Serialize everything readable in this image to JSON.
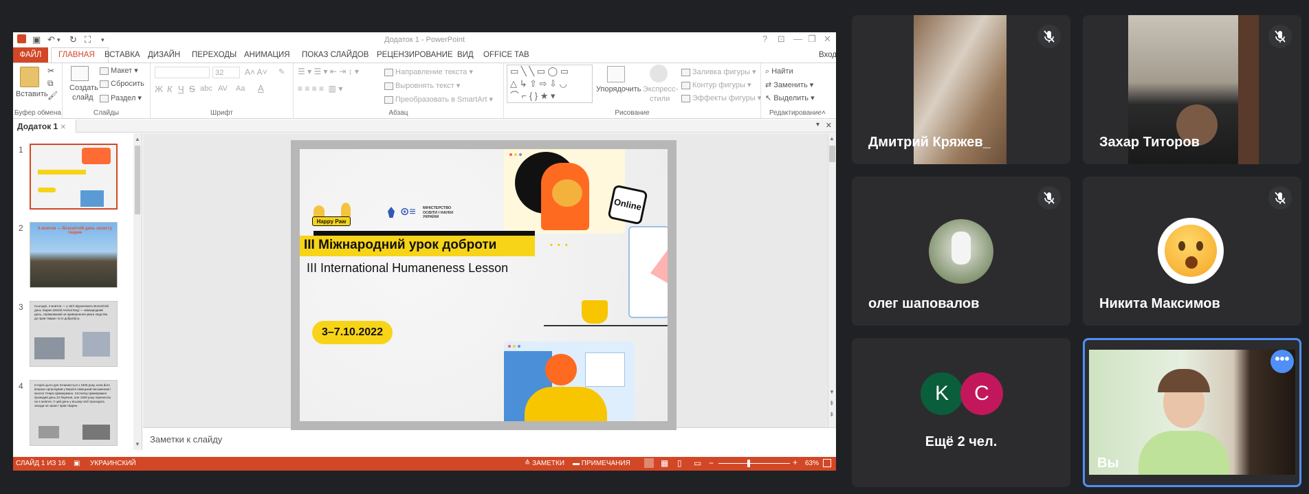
{
  "ppt": {
    "window_title": "Додаток 1 - PowerPoint",
    "menu": {
      "file": "ФАЙЛ",
      "tabs": [
        "ГЛАВНАЯ",
        "ВСТАВКА",
        "ДИЗАЙН",
        "ПЕРЕХОДЫ",
        "АНИМАЦИЯ",
        "ПОКАЗ СЛАЙДОВ",
        "РЕЦЕНЗИРОВАНИЕ",
        "ВИД",
        "OFFICE TAB"
      ],
      "signin": "Вход"
    },
    "ribbon": {
      "paste": "Вставить",
      "clipboard_label": "Буфер обмена",
      "new_slide": "Создать",
      "new_slide2": "слайд",
      "layout": "Макет",
      "reset": "Сбросить",
      "section": "Раздел",
      "slides_label": "Слайды",
      "font_size": "32",
      "bold": "Ж",
      "italic": "К",
      "underline": "Ч",
      "strike": "S",
      "shadow": "abc",
      "spacing": "AV",
      "case": "Aa",
      "font_label": "Шрифт",
      "text_direction": "Направление текста",
      "align_text": "Выровнять текст",
      "smartart": "Преобразовать в SmartArt",
      "paragraph_label": "Абзац",
      "arrange": "Упорядочить",
      "quick_styles": "Экспресс-",
      "quick_styles2": "стили",
      "fill": "Заливка фигуры",
      "outline": "Контур фигуры",
      "effects": "Эффекты фигуры",
      "drawing_label": "Рисование",
      "find": "Найти",
      "replace": "Заменить",
      "select": "Выделить",
      "editing_label": "Редактирование"
    },
    "doc_tab": "Додаток 1",
    "thumbnails": [
      {
        "num": "1"
      },
      {
        "num": "2",
        "text": "4 жовтня — Всесвітній день захисту тварин"
      },
      {
        "num": "3",
        "text": "Сьогодні, 4 жовтня — у світі відзначають Всесвітній день тварин (World Animal Day) — міжнародний день, спрямований на привернення уваги людства до прав тварин та їх добробуту."
      },
      {
        "num": "4",
        "text": "Історія цього дня починається з 1925 року, коли його вперше організував у Берліні німецький письменник і кінолог Генріх Ціммерманн. Спочатку Ціммерманн проводив день 24 березня, але 1929 року перенесли на 4 жовтня. У цей день у всьому світі проходять заходи на захист прав тварин."
      }
    ],
    "slide": {
      "brand": "Happy Paw",
      "ministry": "МІНІСТЕРСТВО ОСВІТИ І НАУКИ УКРАЇНИ",
      "online": "Online",
      "title_ua": "III Міжнародний урок доброти",
      "title_en": "III International Humaneness Lesson",
      "date": "3–7.10.2022",
      "dots": "• • •"
    },
    "notes_placeholder": "Заметки к слайду",
    "status": {
      "slide": "СЛАЙД 1 ИЗ 16",
      "language": "УКРАИНСКИЙ",
      "notes": "ЗАМЕТКИ",
      "comments": "ПРИМЕЧАНИЯ",
      "zoom": "63%",
      "minus": "−",
      "plus": "+"
    }
  },
  "meet": {
    "participants": [
      {
        "name": "Дмитрий Кряжев_",
        "muted": true
      },
      {
        "name": "Захар Титоров",
        "muted": true
      },
      {
        "name": "олег шаповалов",
        "muted": true
      },
      {
        "name": "Никита Максимов",
        "muted": true
      },
      {
        "name": "Ещё 2 чел.",
        "avatars": [
          "K",
          "C"
        ]
      },
      {
        "name": "Вы",
        "active": true
      }
    ],
    "colors": {
      "tile": "#2c2c2e",
      "active_border": "#4f8ff7",
      "avatar_k": "#0b5e3b",
      "avatar_c": "#c2185b",
      "accent": "#d24726"
    }
  }
}
